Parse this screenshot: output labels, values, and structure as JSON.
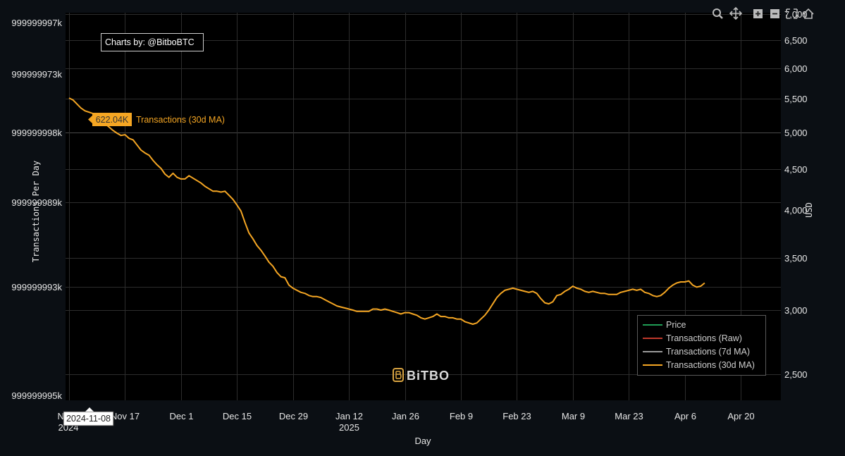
{
  "chart_data": {
    "type": "line",
    "credit": "Charts by: @BitboBTC",
    "logo_text": "BiTBO",
    "xlabel": "Day",
    "ylabel_left": "Transactions Per Day",
    "ylabel_right": "USD",
    "x_ticks": [
      {
        "date": "2024-11-03",
        "label": "N",
        "sub": "2024"
      },
      {
        "date": "2024-11-17",
        "label": "Nov 17",
        "sub": ""
      },
      {
        "date": "2024-12-01",
        "label": "Dec 1",
        "sub": ""
      },
      {
        "date": "2024-12-15",
        "label": "Dec 15",
        "sub": ""
      },
      {
        "date": "2024-12-29",
        "label": "Dec 29",
        "sub": ""
      },
      {
        "date": "2025-01-12",
        "label": "Jan 12",
        "sub": "2025"
      },
      {
        "date": "2025-01-26",
        "label": "Jan 26",
        "sub": ""
      },
      {
        "date": "2025-02-09",
        "label": "Feb 9",
        "sub": ""
      },
      {
        "date": "2025-02-23",
        "label": "Feb 23",
        "sub": ""
      },
      {
        "date": "2025-03-09",
        "label": "Mar 9",
        "sub": ""
      },
      {
        "date": "2025-03-23",
        "label": "Mar 23",
        "sub": ""
      },
      {
        "date": "2025-04-06",
        "label": "Apr 6",
        "sub": ""
      },
      {
        "date": "2025-04-20",
        "label": "Apr 20",
        "sub": ""
      }
    ],
    "y_left_ticks": [
      "999999997k",
      "999999973k",
      "999999998k",
      "999999989k",
      "999999993k",
      "999999995k"
    ],
    "y_right_ticks": [
      "7,000",
      "6,500",
      "6,000",
      "5,500",
      "5,000",
      "4,500",
      "4,000",
      "3,500",
      "3,000",
      "2,500"
    ],
    "y_right_range": [
      2300,
      7000
    ],
    "legend": [
      {
        "name": "Price",
        "color": "#1f9d55"
      },
      {
        "name": "Transactions (Raw)",
        "color": "#c0392b"
      },
      {
        "name": "Transactions (7d MA)",
        "color": "#9a9a9a"
      },
      {
        "name": "Transactions (30d MA)",
        "color": "#f5a623"
      }
    ],
    "hover": {
      "date": "2024-11-08",
      "value": "622.04K",
      "series": "Transactions (30d MA)"
    },
    "series": [
      {
        "name": "Transactions (30d MA)",
        "color": "#f5a623",
        "points": [
          [
            "2024-11-03",
            5510
          ],
          [
            "2024-11-04",
            5480
          ],
          [
            "2024-11-05",
            5420
          ],
          [
            "2024-11-06",
            5360
          ],
          [
            "2024-11-07",
            5320
          ],
          [
            "2024-11-08",
            5300
          ],
          [
            "2024-11-09",
            5280
          ],
          [
            "2024-11-10",
            5240
          ],
          [
            "2024-11-11",
            5200
          ],
          [
            "2024-11-12",
            5130
          ],
          [
            "2024-11-13",
            5080
          ],
          [
            "2024-11-14",
            5030
          ],
          [
            "2024-11-15",
            4990
          ],
          [
            "2024-11-16",
            4960
          ],
          [
            "2024-11-17",
            4970
          ],
          [
            "2024-11-18",
            4920
          ],
          [
            "2024-11-19",
            4900
          ],
          [
            "2024-11-20",
            4830
          ],
          [
            "2024-11-21",
            4760
          ],
          [
            "2024-11-22",
            4720
          ],
          [
            "2024-11-23",
            4690
          ],
          [
            "2024-11-24",
            4620
          ],
          [
            "2024-11-25",
            4560
          ],
          [
            "2024-11-26",
            4510
          ],
          [
            "2024-11-27",
            4440
          ],
          [
            "2024-11-28",
            4400
          ],
          [
            "2024-11-29",
            4450
          ],
          [
            "2024-11-30",
            4400
          ],
          [
            "2024-12-01",
            4380
          ],
          [
            "2024-12-02",
            4380
          ],
          [
            "2024-12-03",
            4420
          ],
          [
            "2024-12-04",
            4390
          ],
          [
            "2024-12-05",
            4360
          ],
          [
            "2024-12-06",
            4330
          ],
          [
            "2024-12-07",
            4290
          ],
          [
            "2024-12-08",
            4260
          ],
          [
            "2024-12-09",
            4230
          ],
          [
            "2024-12-10",
            4230
          ],
          [
            "2024-12-11",
            4220
          ],
          [
            "2024-12-12",
            4230
          ],
          [
            "2024-12-13",
            4180
          ],
          [
            "2024-12-14",
            4130
          ],
          [
            "2024-12-15",
            4060
          ],
          [
            "2024-12-16",
            3990
          ],
          [
            "2024-12-17",
            3870
          ],
          [
            "2024-12-18",
            3760
          ],
          [
            "2024-12-19",
            3700
          ],
          [
            "2024-12-20",
            3630
          ],
          [
            "2024-12-21",
            3580
          ],
          [
            "2024-12-22",
            3520
          ],
          [
            "2024-12-23",
            3460
          ],
          [
            "2024-12-24",
            3420
          ],
          [
            "2024-12-25",
            3360
          ],
          [
            "2024-12-26",
            3320
          ],
          [
            "2024-12-27",
            3310
          ],
          [
            "2024-12-28",
            3240
          ],
          [
            "2024-12-29",
            3210
          ],
          [
            "2024-12-30",
            3190
          ],
          [
            "2024-12-31",
            3170
          ],
          [
            "2025-01-01",
            3160
          ],
          [
            "2025-01-02",
            3140
          ],
          [
            "2025-01-03",
            3130
          ],
          [
            "2025-01-04",
            3130
          ],
          [
            "2025-01-05",
            3120
          ],
          [
            "2025-01-06",
            3100
          ],
          [
            "2025-01-07",
            3080
          ],
          [
            "2025-01-08",
            3060
          ],
          [
            "2025-01-09",
            3040
          ],
          [
            "2025-01-10",
            3030
          ],
          [
            "2025-01-11",
            3020
          ],
          [
            "2025-01-12",
            3010
          ],
          [
            "2025-01-13",
            3000
          ],
          [
            "2025-01-14",
            2990
          ],
          [
            "2025-01-15",
            2990
          ],
          [
            "2025-01-16",
            2990
          ],
          [
            "2025-01-17",
            2990
          ],
          [
            "2025-01-18",
            3010
          ],
          [
            "2025-01-19",
            3010
          ],
          [
            "2025-01-20",
            3000
          ],
          [
            "2025-01-21",
            3010
          ],
          [
            "2025-01-22",
            3000
          ],
          [
            "2025-01-23",
            2990
          ],
          [
            "2025-01-24",
            2980
          ],
          [
            "2025-01-25",
            2970
          ],
          [
            "2025-01-26",
            2980
          ],
          [
            "2025-01-27",
            2980
          ],
          [
            "2025-01-28",
            2970
          ],
          [
            "2025-01-29",
            2960
          ],
          [
            "2025-01-30",
            2940
          ],
          [
            "2025-01-31",
            2930
          ],
          [
            "2025-02-01",
            2940
          ],
          [
            "2025-02-02",
            2950
          ],
          [
            "2025-02-03",
            2970
          ],
          [
            "2025-02-04",
            2950
          ],
          [
            "2025-02-05",
            2950
          ],
          [
            "2025-02-06",
            2940
          ],
          [
            "2025-02-07",
            2940
          ],
          [
            "2025-02-08",
            2930
          ],
          [
            "2025-02-09",
            2930
          ],
          [
            "2025-02-10",
            2910
          ],
          [
            "2025-02-11",
            2900
          ],
          [
            "2025-02-12",
            2890
          ],
          [
            "2025-02-13",
            2900
          ],
          [
            "2025-02-14",
            2930
          ],
          [
            "2025-02-15",
            2960
          ],
          [
            "2025-02-16",
            3000
          ],
          [
            "2025-02-17",
            3060
          ],
          [
            "2025-02-18",
            3120
          ],
          [
            "2025-02-19",
            3160
          ],
          [
            "2025-02-20",
            3190
          ],
          [
            "2025-02-21",
            3200
          ],
          [
            "2025-02-22",
            3210
          ],
          [
            "2025-02-23",
            3200
          ],
          [
            "2025-02-24",
            3190
          ],
          [
            "2025-02-25",
            3180
          ],
          [
            "2025-02-26",
            3170
          ],
          [
            "2025-02-27",
            3180
          ],
          [
            "2025-02-28",
            3160
          ],
          [
            "2025-03-01",
            3110
          ],
          [
            "2025-03-02",
            3070
          ],
          [
            "2025-03-03",
            3060
          ],
          [
            "2025-03-04",
            3080
          ],
          [
            "2025-03-05",
            3140
          ],
          [
            "2025-03-06",
            3150
          ],
          [
            "2025-03-07",
            3180
          ],
          [
            "2025-03-08",
            3200
          ],
          [
            "2025-03-09",
            3230
          ],
          [
            "2025-03-10",
            3210
          ],
          [
            "2025-03-11",
            3200
          ],
          [
            "2025-03-12",
            3180
          ],
          [
            "2025-03-13",
            3170
          ],
          [
            "2025-03-14",
            3180
          ],
          [
            "2025-03-15",
            3170
          ],
          [
            "2025-03-16",
            3160
          ],
          [
            "2025-03-17",
            3160
          ],
          [
            "2025-03-18",
            3150
          ],
          [
            "2025-03-19",
            3150
          ],
          [
            "2025-03-20",
            3150
          ],
          [
            "2025-03-21",
            3170
          ],
          [
            "2025-03-22",
            3180
          ],
          [
            "2025-03-23",
            3190
          ],
          [
            "2025-03-24",
            3200
          ],
          [
            "2025-03-25",
            3190
          ],
          [
            "2025-03-26",
            3200
          ],
          [
            "2025-03-27",
            3170
          ],
          [
            "2025-03-28",
            3160
          ],
          [
            "2025-03-29",
            3140
          ],
          [
            "2025-03-30",
            3130
          ],
          [
            "2025-03-31",
            3140
          ],
          [
            "2025-04-01",
            3170
          ],
          [
            "2025-04-02",
            3210
          ],
          [
            "2025-04-03",
            3240
          ],
          [
            "2025-04-04",
            3260
          ],
          [
            "2025-04-05",
            3270
          ],
          [
            "2025-04-06",
            3270
          ],
          [
            "2025-04-07",
            3280
          ],
          [
            "2025-04-08",
            3240
          ],
          [
            "2025-04-09",
            3220
          ],
          [
            "2025-04-10",
            3230
          ],
          [
            "2025-04-11",
            3260
          ]
        ]
      }
    ]
  }
}
